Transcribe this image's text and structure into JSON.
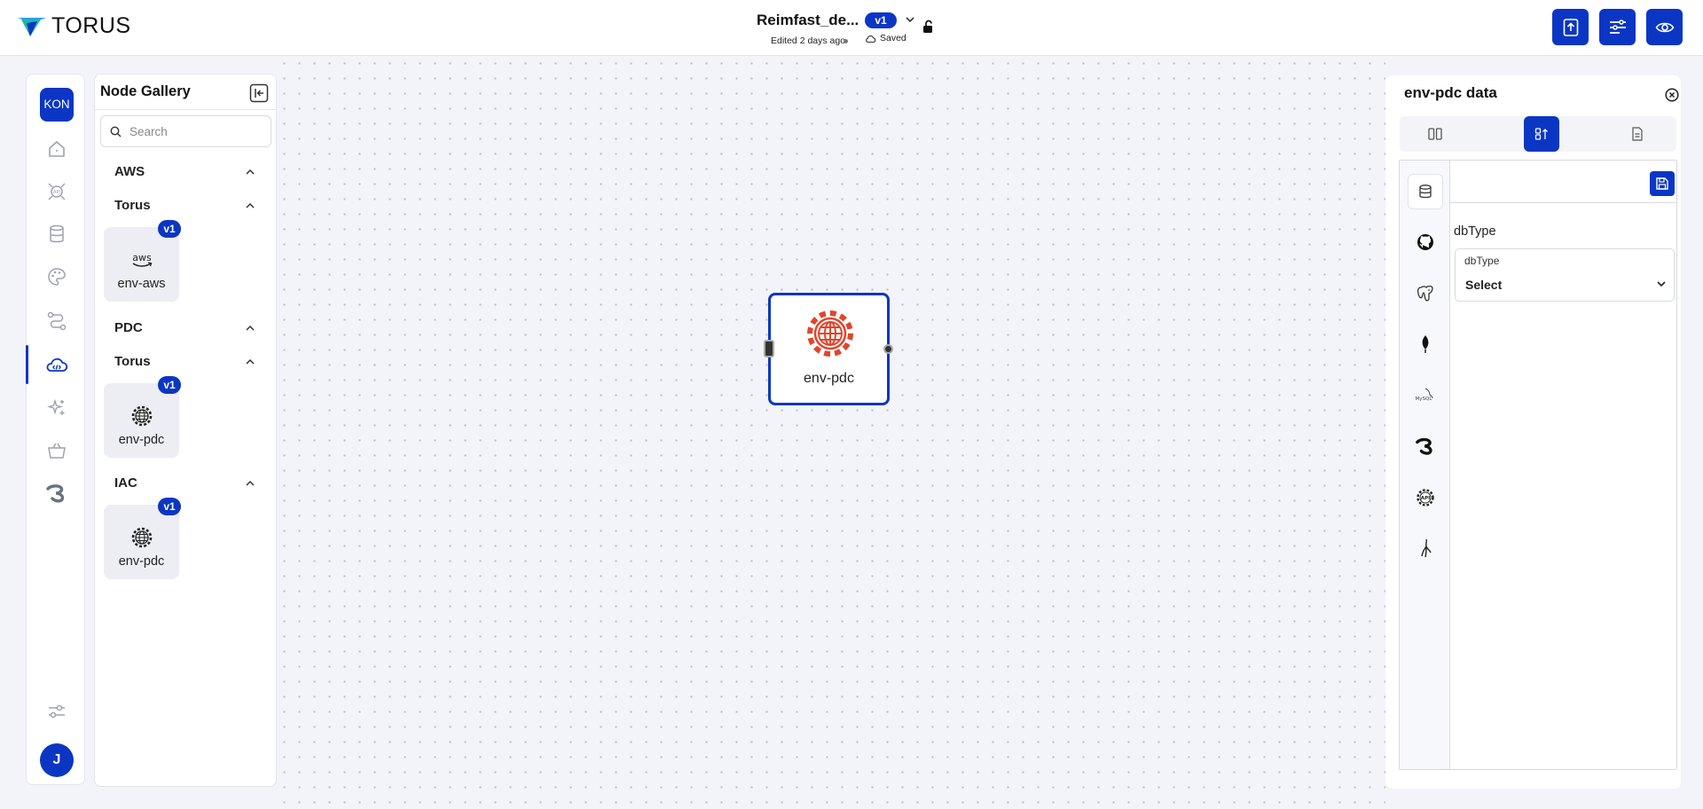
{
  "header": {
    "logo_text": "TORUS",
    "doc_title": "Reimfast_de...",
    "version": "v1",
    "edited": "Edited 2 days ago",
    "saved": "Saved"
  },
  "rail": {
    "workspace_initials": "KON",
    "user_initial": "J"
  },
  "gallery": {
    "title": "Node Gallery",
    "search_placeholder": "Search",
    "sections": [
      {
        "label": "AWS"
      },
      {
        "label": "Torus",
        "cards": [
          {
            "badge": "v1",
            "label": "env-aws",
            "icon": "aws-icon"
          }
        ]
      },
      {
        "label": "PDC"
      },
      {
        "label": "Torus",
        "cards": [
          {
            "badge": "v1",
            "label": "env-pdc",
            "icon": "globe-gear-icon"
          }
        ]
      },
      {
        "label": "IAC",
        "cards": [
          {
            "badge": "v1",
            "label": "env-pdc",
            "icon": "globe-gear-icon"
          }
        ]
      }
    ]
  },
  "canvas": {
    "node": {
      "label": "env-pdc",
      "icon": "globe-gear-icon"
    }
  },
  "panel": {
    "title": "env-pdc data",
    "field_heading": "dbType",
    "field_label": "dbType",
    "field_value": "Select"
  },
  "colors": {
    "accent": "#0b36c4",
    "node_icon": "#e2452b",
    "canvas_bg": "#f3f4f9"
  }
}
